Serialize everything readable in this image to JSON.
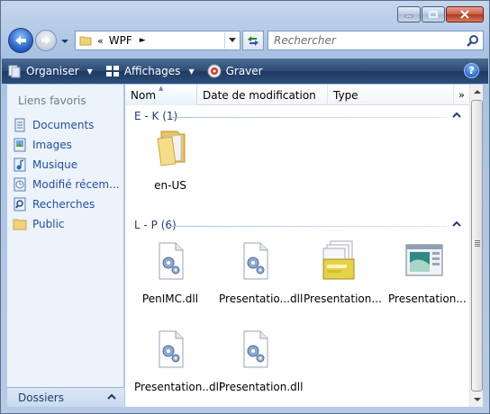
{
  "window": {
    "minimize_icon": "minimize-icon",
    "maximize_icon": "maximize-icon",
    "close_icon": "close-icon"
  },
  "address": {
    "chevrons": "«",
    "crumb": "WPF",
    "arrow": "►",
    "search_placeholder": "Rechercher"
  },
  "toolbar": {
    "organiser": "Organiser",
    "affichages": "Affichages",
    "graver": "Graver",
    "help": "?"
  },
  "nav": {
    "title": "Liens favoris",
    "items": [
      {
        "label": "Documents",
        "icon": "documents-icon"
      },
      {
        "label": "Images",
        "icon": "images-icon"
      },
      {
        "label": "Musique",
        "icon": "music-icon"
      },
      {
        "label": "Modifié récem...",
        "icon": "recent-icon"
      },
      {
        "label": "Recherches",
        "icon": "searches-icon"
      },
      {
        "label": "Public",
        "icon": "public-folder-icon"
      }
    ],
    "folders_label": "Dossiers"
  },
  "columns": {
    "name": "Nom",
    "date": "Date de modification",
    "type": "Type",
    "more": "»"
  },
  "groups": [
    {
      "title": "E - K (1)",
      "items": [
        {
          "label": "en-US",
          "icon": "folder-icon"
        }
      ]
    },
    {
      "title": "L - P (6)",
      "items": [
        {
          "label": "PenIMC.dll",
          "icon": "dll-icon"
        },
        {
          "label": "Presentatio...dll",
          "icon": "dll-icon"
        },
        {
          "label": "Presentation...",
          "icon": "presentation-stack-icon"
        },
        {
          "label": "Presentation...",
          "icon": "presentation-window-icon"
        },
        {
          "label": "Presentation..dll",
          "icon": "dll-icon"
        },
        {
          "label": "Presentation.dll",
          "icon": "dll-icon"
        }
      ]
    }
  ],
  "colors": {
    "toolbar": "#2c4a73",
    "nav_bg": "#edf3fb",
    "link": "#1f4fa6",
    "group_title": "#1f3a7a"
  }
}
